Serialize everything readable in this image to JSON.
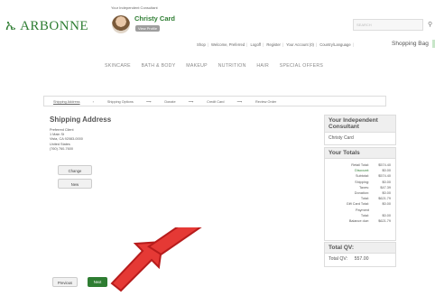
{
  "header": {
    "logo": "ARBONNE",
    "consultant_label": "Your Independent Consultant",
    "consultant_name": "Christy Card",
    "view_profile": "View Profile",
    "search_placeholder": "SEARCH",
    "shopping_bag": "Shopping Bag"
  },
  "util_links": [
    "Shop",
    "Welcome, Preferred",
    "Logoff",
    "Register",
    "Your Account (0)",
    "Country/Language"
  ],
  "main_nav": [
    "SKINCARE",
    "BATH & BODY",
    "MAKEUP",
    "NUTRITION",
    "HAIR",
    "SPECIAL OFFERS"
  ],
  "steps": [
    "Shipping Address",
    "Shipping Options",
    "Donate",
    "Credit Card",
    "Review Order"
  ],
  "shipping": {
    "title": "Shipping Address",
    "lines": [
      "Preferred Client",
      "1 Main St",
      "Vista, CA 92083-0000",
      "United States",
      "(760) 760-7600"
    ],
    "change_label": "Change",
    "new_label": "New"
  },
  "consultant_panel": {
    "title": "Your Independent Consultant",
    "name": "Christy Card"
  },
  "totals_panel": {
    "title": "Your Totals",
    "rows": [
      {
        "label": "Retail Total:",
        "value": "$574.40"
      },
      {
        "label": "Discount:",
        "value": "$0.00"
      },
      {
        "label": "Subtotal:",
        "value": "$574.40"
      },
      {
        "label": "Shipping:",
        "value": "$0.00"
      },
      {
        "label": "Taxes:",
        "value": "$47.39"
      },
      {
        "label": "Donation:",
        "value": "$0.00"
      },
      {
        "label": "Total:",
        "value": "$621.79"
      },
      {
        "label": "Gift Card Total:",
        "value": "$0.00"
      },
      {
        "label": "Payment",
        "value": ""
      },
      {
        "label": "Total:",
        "value": "$0.00"
      },
      {
        "label": "Balance due:",
        "value": "$621.79"
      }
    ]
  },
  "qv_panel": {
    "title": "Total QV:",
    "label": "Total QV:",
    "value": "557.00"
  },
  "footer": {
    "previous_label": "Previous",
    "next_label": "Next"
  },
  "colors": {
    "brand_green": "#2e7d32",
    "arrow_red": "#e53935"
  }
}
